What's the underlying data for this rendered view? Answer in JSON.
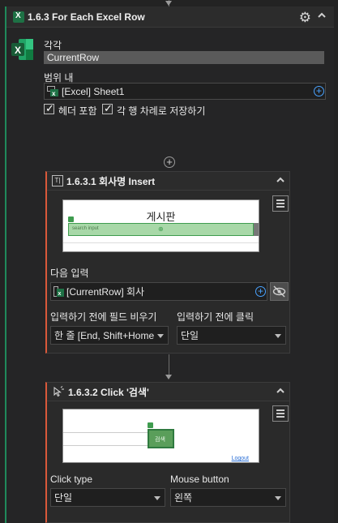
{
  "outer": {
    "title": "1.6.3 For Each Excel Row",
    "each_label": "각각",
    "each_value": "CurrentRow",
    "range_label": "범위 내",
    "range_value": "[Excel] Sheet1",
    "checkbox_header": "헤더 포함",
    "checkbox_save": "각 행 차례로 저장하기"
  },
  "card1": {
    "title": "1.6.3.1 회사명 Insert",
    "thumb_text": "게시판",
    "thumb_input_hint": "search input",
    "next_input_label": "다음 입력",
    "next_input_value": "[CurrentRow] 회사",
    "clear_label": "입력하기 전에 필드 비우기",
    "clear_value": "한 줄 [End, Shift+Home",
    "click_label": "입력하기 전에 클릭",
    "click_value": "단일"
  },
  "card2": {
    "title": "1.6.3.2 Click '검색'",
    "thumb_button": "검색",
    "thumb_logout": "Logout",
    "click_type_label": "Click type",
    "click_type_value": "단일",
    "mouse_button_label": "Mouse button",
    "mouse_button_value": "왼쪽"
  },
  "colors": {
    "accent_green": "#1f8a5b",
    "accent_orange": "#d9583a",
    "link_blue": "#4aa3ff"
  }
}
